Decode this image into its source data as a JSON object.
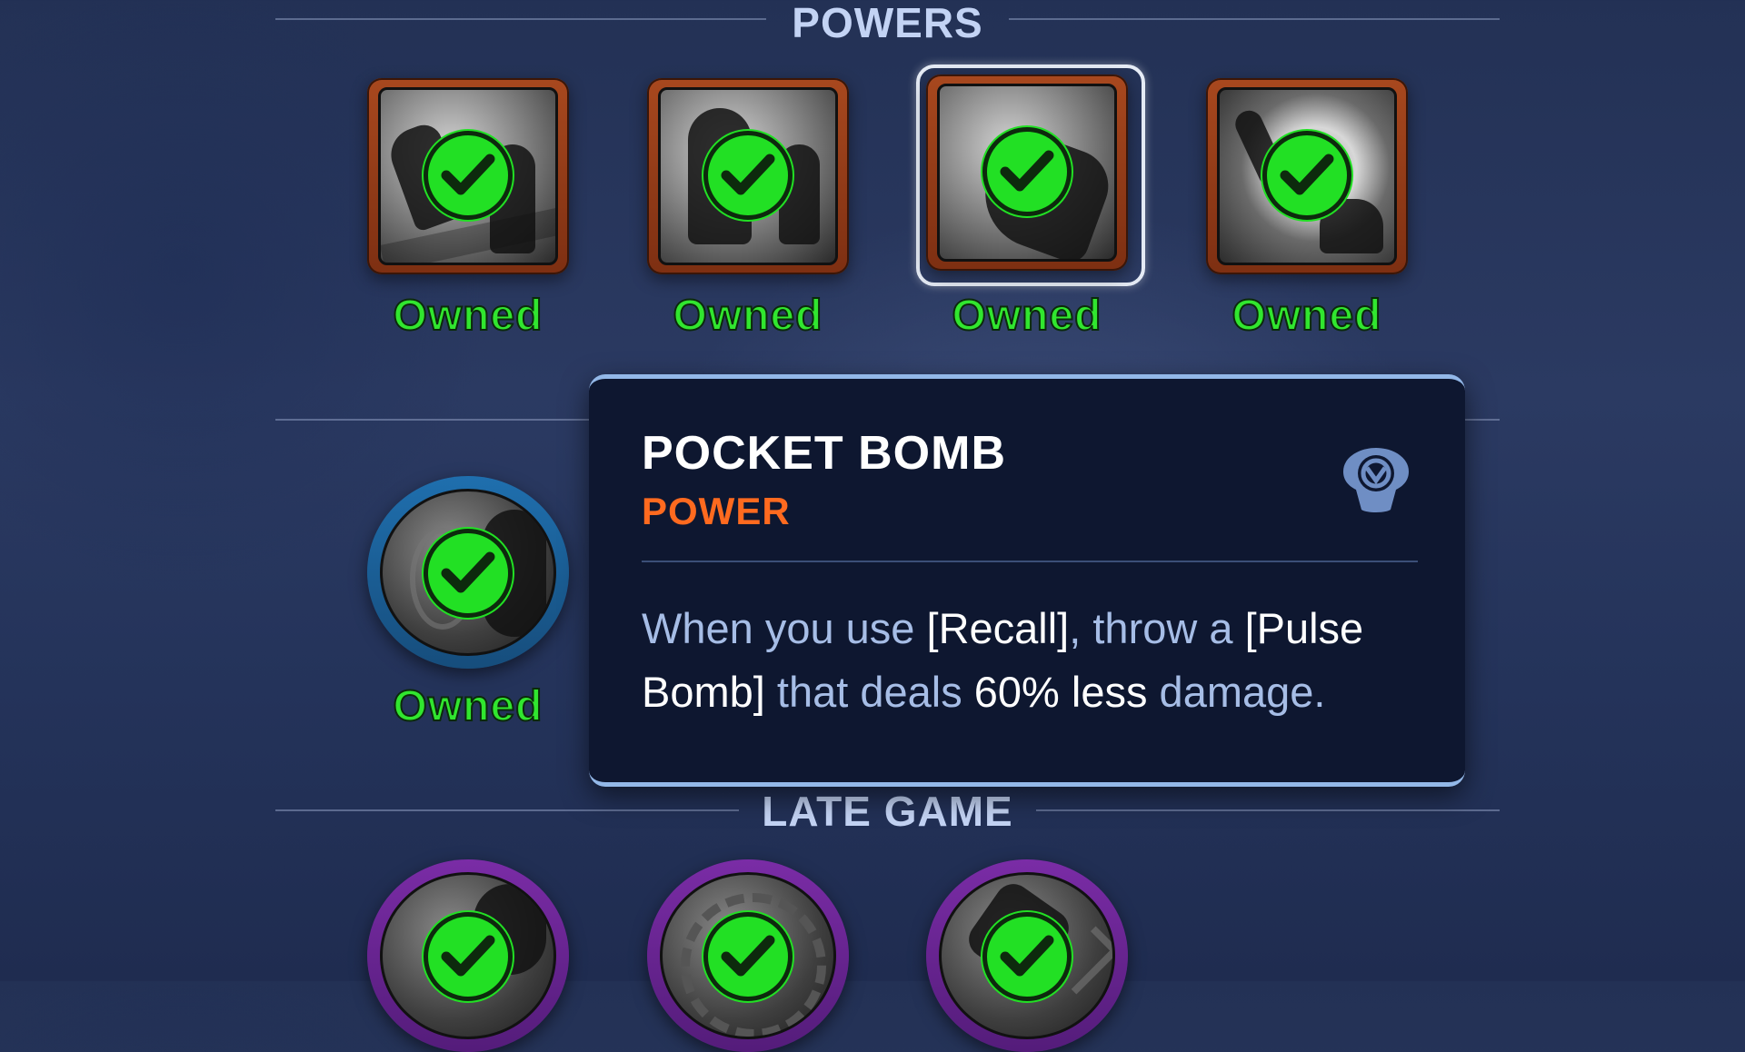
{
  "sections": {
    "powers_title": "POWERS",
    "late_game_title": "LATE GAME"
  },
  "powers": [
    {
      "status": "Owned",
      "icon": "power-icon-1"
    },
    {
      "status": "Owned",
      "icon": "power-icon-2"
    },
    {
      "status": "Owned",
      "icon": "power-icon-3",
      "selected": true
    },
    {
      "status": "Owned",
      "icon": "power-icon-4"
    }
  ],
  "middle_item": {
    "status": "Owned",
    "icon": "item-icon"
  },
  "late_game_items": [
    {
      "icon": "late-item-icon-1"
    },
    {
      "icon": "late-item-icon-2"
    },
    {
      "icon": "late-item-icon-3"
    }
  ],
  "tooltip": {
    "title": "POCKET BOMB",
    "type": "POWER",
    "desc_1": "When you use ",
    "desc_2": "[Recall]",
    "desc_3": ", throw a ",
    "desc_4": "[Pulse Bomb]",
    "desc_5": " that deals ",
    "desc_6": "60% less",
    "desc_7": " damage.",
    "emblem_icon": "hero-emblem-icon"
  },
  "colors": {
    "owned": "#31e62f",
    "power_frame": "#a8481e",
    "item_frame_blue": "#1f6fae",
    "late_frame_purple": "#7a2ca6",
    "tooltip_type": "#ff6a1f",
    "tooltip_border": "#93b8e8"
  }
}
